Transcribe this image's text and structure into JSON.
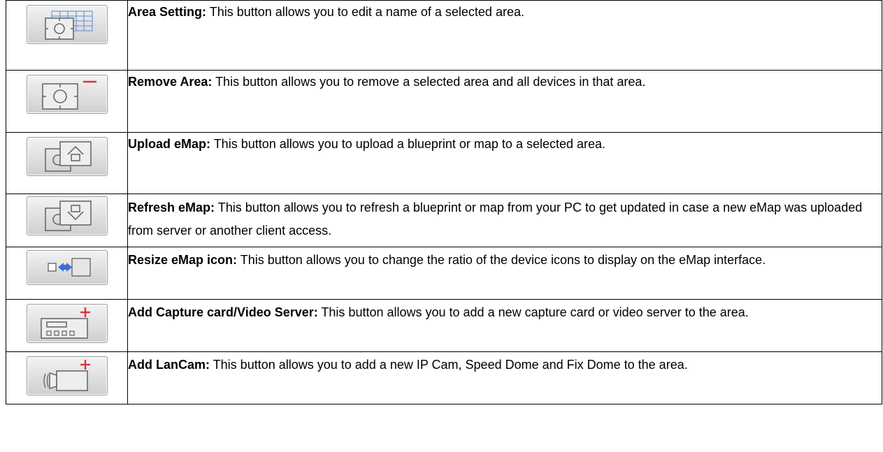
{
  "rows": [
    {
      "icon": "area-setting-icon",
      "term": "Area Setting:",
      "desc": " This button allows you to edit a name of a selected area."
    },
    {
      "icon": "remove-area-icon",
      "term": "Remove Area:",
      "desc": " This button allows you to remove a selected area and all devices in that area."
    },
    {
      "icon": "upload-emap-icon",
      "term": "Upload eMap:",
      "desc": " This button allows you to upload a blueprint or map to a selected area."
    },
    {
      "icon": "refresh-emap-icon",
      "term": "Refresh eMap:",
      "desc": " This button allows you to refresh a blueprint or map from your PC to get updated in case a new eMap was uploaded from server or another client access."
    },
    {
      "icon": "resize-emap-icon",
      "term": "Resize eMap icon:",
      "desc": " This button allows you to change the ratio of the device icons to display on the eMap interface."
    },
    {
      "icon": "add-capture-card-icon",
      "term": "Add Capture card/Video Server:",
      "desc": " This button allows you to add a new capture card or video server to the area."
    },
    {
      "icon": "add-lancam-icon",
      "term": "Add LanCam:",
      "desc": " This button allows you to add a new IP Cam, Speed Dome and Fix Dome to the area."
    }
  ],
  "colors": {
    "icon_line": "#6a6a6a",
    "accent_red": "#e0303a",
    "accent_blue": "#3a6fd8",
    "grid_blue": "#7a9ad0"
  }
}
